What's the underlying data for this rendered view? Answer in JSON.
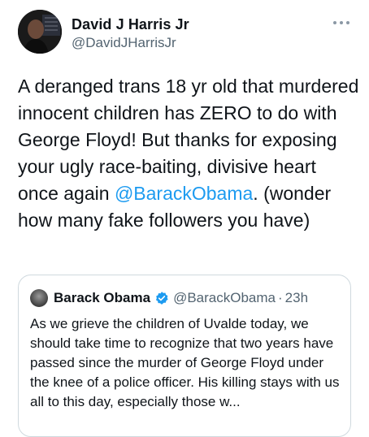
{
  "tweet": {
    "author": {
      "name": "David J Harris Jr",
      "handle": "@DavidJHarrisJr"
    },
    "text_before_mention": "A deranged trans 18 yr old that murdered innocent children has ZERO to do with George Floyd! But thanks for exposing your ugly race-baiting, divisive heart once again ",
    "mention": "@BarackObama",
    "text_after_mention": ". (wonder how many fake followers you have)",
    "more_icon": "more-horizontal-icon"
  },
  "quote": {
    "author": {
      "name": "Barack Obama",
      "handle": "@BarackObama",
      "verified": true
    },
    "separator": "·",
    "time": "23h",
    "text": "As we grieve the children of Uvalde today, we should take time to recognize that two years have passed since the murder of George Floyd under the knee of a police officer. His killing stays with us all to this day, especially those w..."
  },
  "colors": {
    "text": "#0f1419",
    "secondary": "#536471",
    "link": "#1d9bf0",
    "border": "#cfd9de"
  }
}
